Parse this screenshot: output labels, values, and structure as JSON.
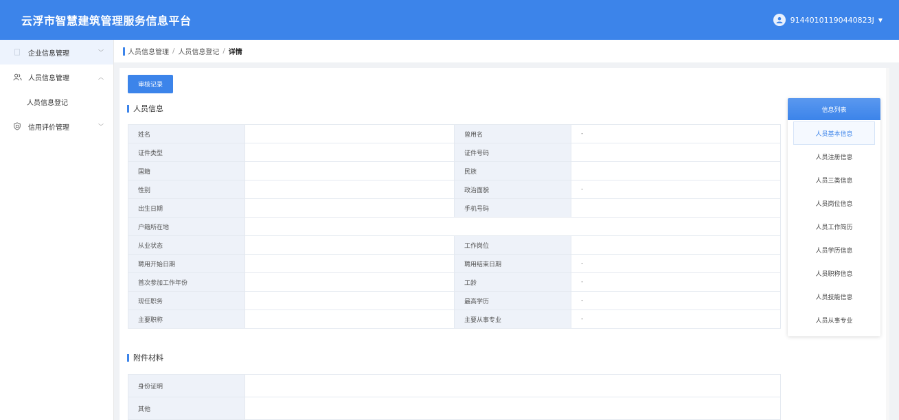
{
  "header": {
    "title": "云浮市智慧建筑管理服务信息平台",
    "username": "91440101190440823J"
  },
  "sidebar": {
    "items": [
      {
        "label": "企业信息管理"
      },
      {
        "label": "人员信息管理"
      },
      {
        "label": "人员信息登记"
      },
      {
        "label": "信用评价管理"
      }
    ]
  },
  "breadcrumb": {
    "items": [
      "人员信息管理",
      "人员信息登记",
      "详情"
    ]
  },
  "main": {
    "audit_button": "审核记录",
    "person_section_title": "人员信息",
    "attachment_section_title": "附件材料",
    "fields": {
      "name_label": "姓名",
      "name_value": "",
      "former_name_label": "曾用名",
      "former_name_value": "-",
      "id_type_label": "证件类型",
      "id_type_value": "",
      "id_number_label": "证件号码",
      "id_number_value": "",
      "nationality_label": "国籍",
      "nationality_value": "",
      "ethnicity_label": "民族",
      "ethnicity_value": "",
      "gender_label": "性别",
      "gender_value": "",
      "political_label": "政治面貌",
      "political_value": "-",
      "birth_label": "出生日期",
      "birth_value": "",
      "phone_label": "手机号码",
      "phone_value": "",
      "domicile_label": "户籍所在地",
      "domicile_value": "",
      "employment_label": "从业状态",
      "employment_value": "",
      "post_label": "工作岗位",
      "post_value": "",
      "hire_start_label": "聘用开始日期",
      "hire_start_value": "",
      "hire_end_label": "聘用结束日期",
      "hire_end_value": "-",
      "first_work_label": "首次参加工作年份",
      "first_work_value": "",
      "seniority_label": "工龄",
      "seniority_value": "-",
      "position_label": "现任职务",
      "position_value": "",
      "education_label": "最高学历",
      "education_value": "-",
      "title_label": "主要职称",
      "title_value": "",
      "major_label": "主要从事专业",
      "major_value": "-"
    },
    "attachments": {
      "id_proof_label": "身份证明",
      "other_label": "其他"
    }
  },
  "info_panel": {
    "title": "信息列表",
    "items": [
      "人员基本信息",
      "人员注册信息",
      "人员三类信息",
      "人员岗位信息",
      "人员工作简历",
      "人员学历信息",
      "人员职称信息",
      "人员技能信息",
      "人员从事专业"
    ]
  },
  "colors": {
    "primary": "#3c84ea",
    "label_bg": "#eef2f9"
  }
}
